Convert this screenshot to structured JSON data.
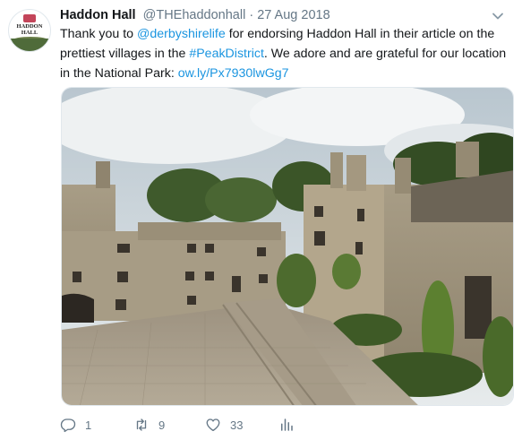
{
  "tweet": {
    "author_name": "Haddon Hall",
    "handle": "@THEhaddonhall",
    "separator": " · ",
    "date": "27 Aug 2018",
    "text_part1": "Thank you to ",
    "mention": "@derbyshirelife",
    "text_part2": " for endorsing Haddon Hall in their article on the prettiest villages in the ",
    "hashtag": "#PeakDistrict",
    "text_part3": ". We adore and are grateful for our location in the National Park: ",
    "url": "ow.ly/Px7930lwGg7"
  },
  "avatar": {
    "logo_text_1": "HADDON",
    "logo_text_2": "HALL"
  },
  "photo": {
    "subject": "Haddon Hall courtyard"
  },
  "actions": {
    "reply_count": "1",
    "retweet_count": "9",
    "like_count": "33"
  },
  "icons": {
    "caret": "chevron-down-icon",
    "reply": "reply-icon",
    "retweet": "retweet-icon",
    "like": "heart-icon",
    "analytics": "analytics-icon"
  },
  "colors": {
    "link": "#1b95e0",
    "muted": "#657786",
    "text": "#14171a"
  }
}
